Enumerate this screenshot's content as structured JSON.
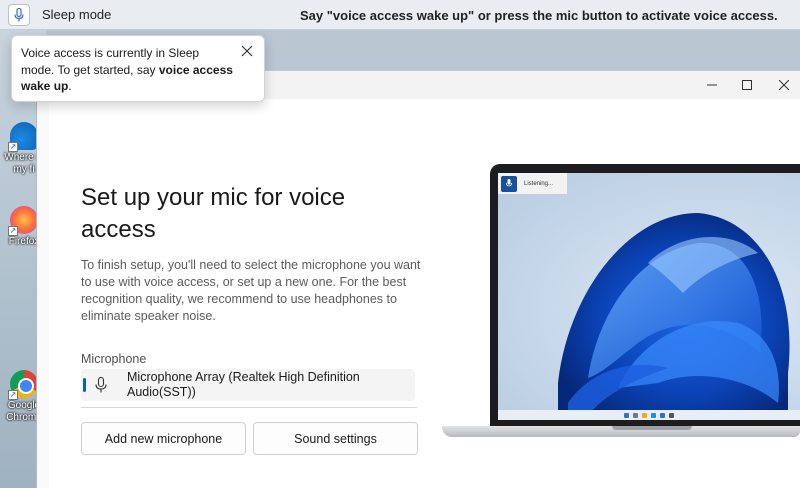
{
  "voice_access": {
    "status": "Sleep mode",
    "hint": "Say \"voice access wake up\" or press the mic button to activate voice access."
  },
  "tooltip": {
    "text_before": "Voice access is currently in Sleep mode. To get started, say ",
    "bold": "voice access wake up",
    "text_after": "."
  },
  "desktop": {
    "icons": [
      {
        "label": "Where is my fi",
        "icon": "onedrive-icon"
      },
      {
        "label": "Firefox",
        "icon": "firefox-icon"
      },
      {
        "label": "Google Chrome",
        "icon": "chrome-icon"
      }
    ]
  },
  "window": {
    "heading": "Set up your mic for voice access",
    "description": "To finish setup, you'll need to select the microphone you want to use with voice access, or set up a new one. For the best recognition quality, we recommend to use headphones to eliminate speaker noise.",
    "microphone_label": "Microphone",
    "microphone_value": "Microphone Array (Realtek High Definition Audio(SST))",
    "add_button": "Add new microphone",
    "sound_button": "Sound settings"
  },
  "illustration": {
    "listening_text": "Listening..."
  },
  "colors": {
    "accent": "#0a5fb4",
    "mic_blue": "#2f6fd1"
  }
}
